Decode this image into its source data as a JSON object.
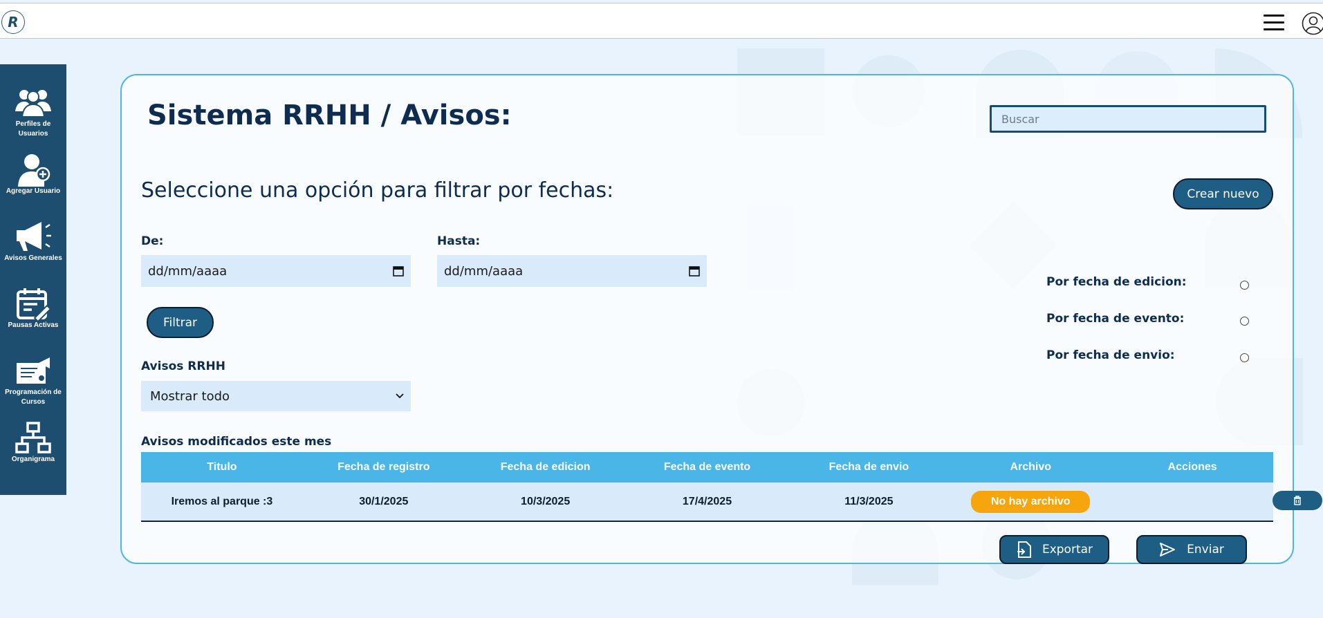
{
  "header": {
    "logo_letter": "R"
  },
  "sidebar": {
    "items": [
      {
        "label": "Perfiles de Usuarios",
        "icon": "users-icon"
      },
      {
        "label": "Agregar Usuario",
        "icon": "add-user-icon"
      },
      {
        "label": "Avisos Generales",
        "icon": "megaphone-icon"
      },
      {
        "label": "Pausas Activas",
        "icon": "calendar-edit-icon"
      },
      {
        "label": "Programación de Cursos",
        "icon": "course-certificate-icon"
      },
      {
        "label": "Organigrama",
        "icon": "org-chart-icon"
      }
    ]
  },
  "main": {
    "title": "Sistema RRHH / Avisos:",
    "search_placeholder": "Buscar",
    "filter_title": "Seleccione una opción para filtrar por fechas:",
    "create_button": "Crear nuevo",
    "from_label": "De:",
    "from_value": "dd/mm/aaaa",
    "to_label": "Hasta:",
    "to_value": "dd/mm/aaaa",
    "filter_button": "Filtrar",
    "radios": [
      {
        "label": "Por fecha de edicion:",
        "checked": false
      },
      {
        "label": "Por fecha de evento:",
        "checked": false
      },
      {
        "label": "Por fecha de envio:",
        "checked": false
      }
    ],
    "select_label": "Avisos RRHH",
    "select_value": "Mostrar todo",
    "table_caption": "Avisos modificados este mes",
    "table": {
      "columns": [
        "Titulo",
        "Fecha de registro",
        "Fecha de edicion",
        "Fecha de evento",
        "Fecha de envio",
        "Archivo",
        "Acciones"
      ],
      "rows": [
        {
          "titulo": "Iremos al parque :3",
          "registro": "30/1/2025",
          "edicion": "10/3/2025",
          "evento": "17/4/2025",
          "envio": "11/3/2025",
          "archivo": "No hay archivo"
        }
      ]
    },
    "export_button": "Exportar",
    "send_button": "Enviar"
  },
  "colors": {
    "sidebar": "#1e4e6f",
    "accent": "#49b6e7",
    "button": "#1e5d84",
    "badge": "#f6a50c",
    "background": "#e9f3fd"
  }
}
